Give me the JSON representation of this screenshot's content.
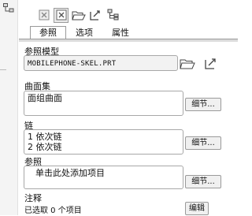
{
  "tabs": [
    {
      "label": "参照",
      "active": true
    },
    {
      "label": "选项",
      "active": false
    },
    {
      "label": "属性",
      "active": false
    }
  ],
  "toolbar": {
    "icons": [
      "copy-disabled-icon",
      "copy-ref-icon",
      "open-folder-icon",
      "model-ref-icon",
      "model-tree-icon"
    ]
  },
  "reference_model": {
    "label": "参照模型",
    "value": "MOBILEPHONE-SKEL.PRT"
  },
  "surface_set": {
    "label": "曲面集",
    "items": [
      "面组曲面"
    ],
    "detail_button": "细节..."
  },
  "chain": {
    "label": "链",
    "items": [
      "1 依次链",
      "2 依次链"
    ],
    "detail_button": "细节..."
  },
  "references": {
    "label": "参照",
    "placeholder": "单击此处添加项目",
    "detail_button": "细节..."
  },
  "notes": {
    "label": "注释",
    "status": "已选取 0 个项目",
    "edit_button": "编辑"
  },
  "colors": {
    "panel_border": "#9a9a9a",
    "field_border": "#a8a8a8",
    "model_field_bg": "#f2f2f2",
    "folder_yellow": "#e8c24a"
  }
}
